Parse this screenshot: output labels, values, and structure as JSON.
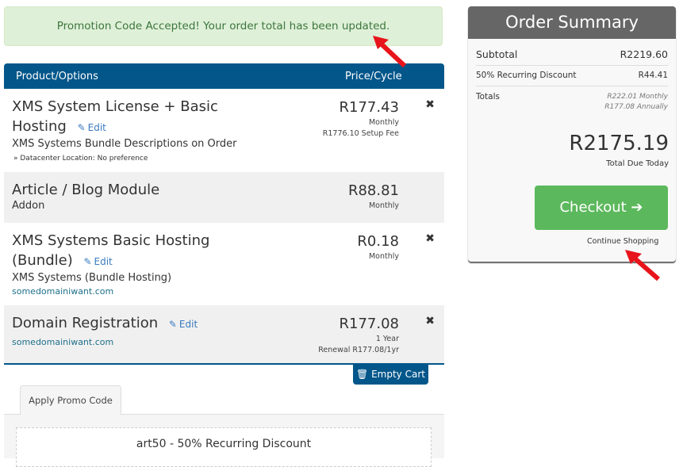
{
  "alert": {
    "message": "Promotion Code Accepted! Your order total has been updated."
  },
  "cart": {
    "headers": {
      "product": "Product/Options",
      "price": "Price/Cycle"
    },
    "items": [
      {
        "name_line1": "XMS System License + Basic",
        "name_line2": "Hosting",
        "edit": "Edit",
        "description": "XMS Systems Bundle Descriptions on Order",
        "option": "» Datacenter Location: No preference",
        "price": "R177.43",
        "cycle": "Monthly",
        "extra": "R1776.10 Setup Fee",
        "removable": true
      },
      {
        "name_line1": "Article / Blog Module",
        "description": "Addon",
        "price": "R88.81",
        "cycle": "Monthly",
        "removable": false
      },
      {
        "name_line1": "XMS Systems Basic Hosting",
        "name_line2": "(Bundle)",
        "edit": "Edit",
        "description": "XMS Systems (Bundle Hosting)",
        "domain": "somedomainiwant.com",
        "price": "R0.18",
        "cycle": "Monthly",
        "removable": true
      },
      {
        "name_line1": "Domain Registration",
        "edit": "Edit",
        "domain": "somedomainiwant.com",
        "price": "R177.08",
        "cycle": "1 Year",
        "extra": "Renewal R177.08/1yr",
        "removable": true
      }
    ],
    "empty_cart": "Empty Cart"
  },
  "promo": {
    "tab": "Apply Promo Code",
    "applied": "art50 - 50% Recurring Discount"
  },
  "summary": {
    "title": "Order Summary",
    "subtotal_label": "Subtotal",
    "subtotal": "R2219.60",
    "discount_label": "50% Recurring Discount",
    "discount": "R44.41",
    "totals_label": "Totals",
    "totals_monthly": "R222.01 Monthly",
    "totals_annually": "R177.08 Annually",
    "total_due": "R2175.19",
    "total_due_label": "Total Due Today",
    "checkout": "Checkout",
    "continue": "Continue Shopping"
  },
  "colors": {
    "primary": "#02568a",
    "success": "#5cb85c",
    "alert_bg": "#dff0d8",
    "summary_header": "#666666",
    "annotation_arrow": "#e8141b"
  }
}
